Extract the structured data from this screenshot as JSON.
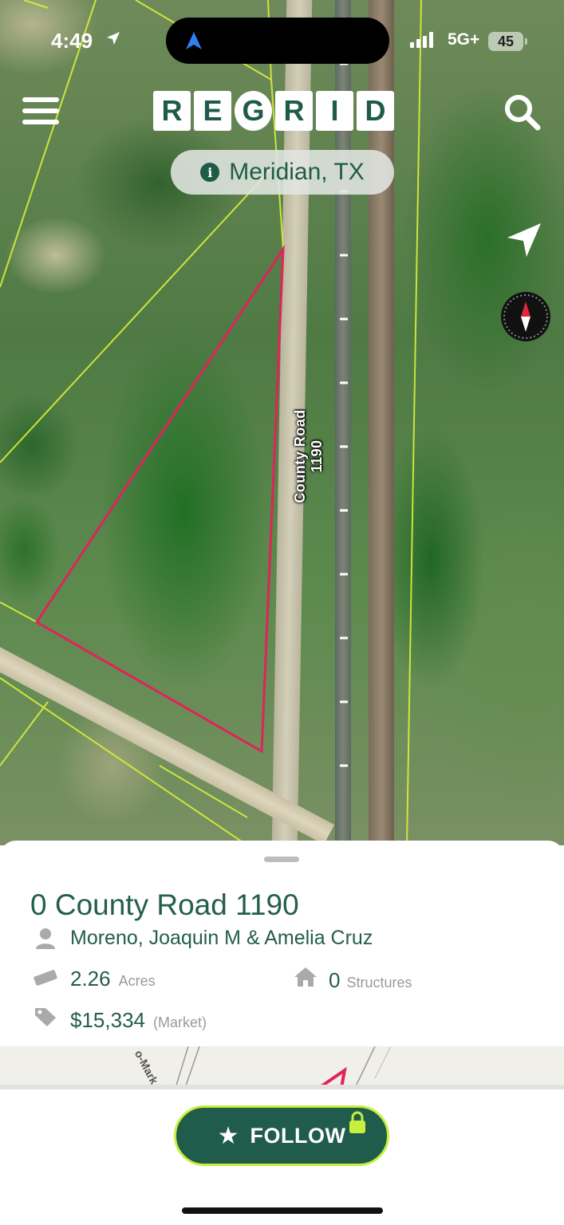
{
  "status_bar": {
    "time": "4:49",
    "network": "5G+",
    "battery": "45"
  },
  "header": {
    "logo_letters": [
      "R",
      "E",
      "G",
      "R",
      "I",
      "D"
    ],
    "location": "Meridian, TX"
  },
  "map": {
    "road_label": "County Road 1190",
    "mini_map_label": "o-Mark",
    "parcel_color": "#e0235a",
    "boundary_color": "#d8ef3a"
  },
  "parcel": {
    "address": "0 County Road 1190",
    "owner": "Moreno, Joaquin M & Amelia Cruz",
    "acres_value": "2.26",
    "acres_unit": "Acres",
    "structures_value": "0",
    "structures_unit": "Structures",
    "price_value": "$15,334",
    "price_unit": "(Market)"
  },
  "actions": {
    "follow_label": "FOLLOW"
  },
  "colors": {
    "brand_green": "#1f5c4c",
    "accent_lime": "#c7ef3d"
  },
  "icons": [
    "location-arrow-icon",
    "menu-icon",
    "search-icon",
    "info-icon",
    "navigation-icon",
    "compass-icon",
    "person-icon",
    "ruler-icon",
    "home-icon",
    "tag-icon",
    "star-icon",
    "lock-icon"
  ]
}
